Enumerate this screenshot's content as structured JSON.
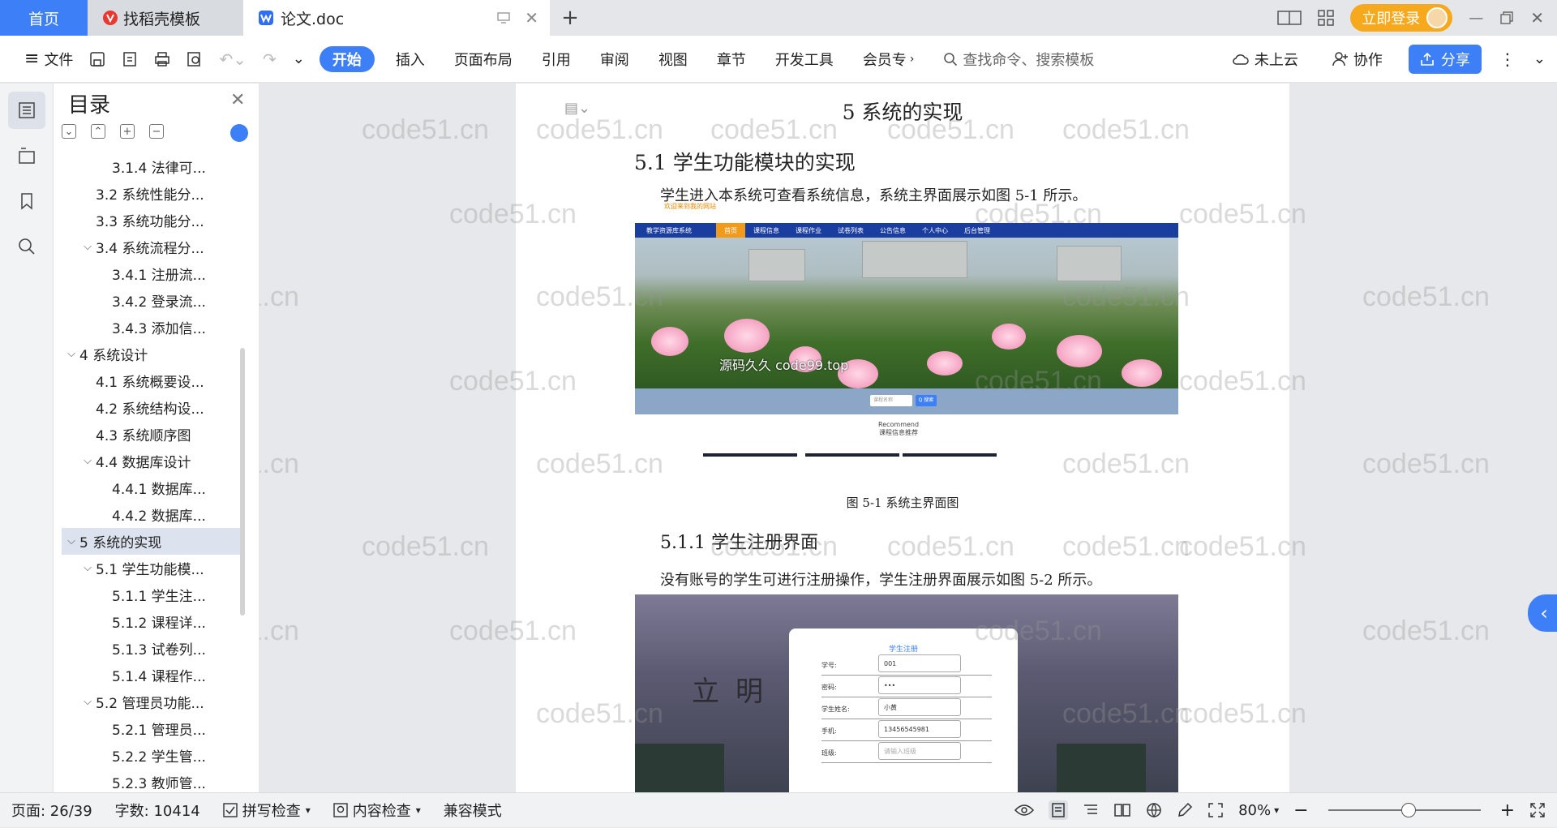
{
  "titlebar": {
    "home_tab": "首页",
    "template_tab": "找稻壳模板",
    "doc_tab": "论文.doc",
    "add_tab": "+",
    "login": "立即登录"
  },
  "ribbon": {
    "file": "文件",
    "tabs": [
      "开始",
      "插入",
      "页面布局",
      "引用",
      "审阅",
      "视图",
      "章节",
      "开发工具",
      "会员专"
    ],
    "search": "查找命令、搜索模板",
    "cloud": "未上云",
    "collab": "协作",
    "share": "分享"
  },
  "toc": {
    "title": "目录",
    "items": [
      {
        "label": "3.1.4 法律可...",
        "level": 3
      },
      {
        "label": "3.2 系统性能分...",
        "level": 2
      },
      {
        "label": "3.3 系统功能分...",
        "level": 2
      },
      {
        "label": "3.4 系统流程分...",
        "level": 2,
        "arrow": "⌵"
      },
      {
        "label": "3.4.1 注册流...",
        "level": 3
      },
      {
        "label": "3.4.2 登录流...",
        "level": 3
      },
      {
        "label": "3.4.3 添加信...",
        "level": 3
      },
      {
        "label": "4  系统设计",
        "level": 1,
        "arrow": "⌵"
      },
      {
        "label": "4.1 系统概要设...",
        "level": 2
      },
      {
        "label": "4.2 系统结构设...",
        "level": 2
      },
      {
        "label": "4.3  系统顺序图",
        "level": 2
      },
      {
        "label": "4.4 数据库设计",
        "level": 2,
        "arrow": "⌵"
      },
      {
        "label": "4.4.1  数据库...",
        "level": 3
      },
      {
        "label": "4.4.2  数据库...",
        "level": 3
      },
      {
        "label": "5  系统的实现",
        "level": 1,
        "arrow": "⌵",
        "selected": true
      },
      {
        "label": "5.1 学生功能模...",
        "level": 2,
        "arrow": "⌵"
      },
      {
        "label": "5.1.1  学生注...",
        "level": 3
      },
      {
        "label": "5.1.2  课程详...",
        "level": 3
      },
      {
        "label": "5.1.3  试卷列...",
        "level": 3
      },
      {
        "label": "5.1.4  课程作...",
        "level": 3
      },
      {
        "label": "5.2 管理员功能...",
        "level": 2,
        "arrow": "⌵"
      },
      {
        "label": "5.2.1  管理员...",
        "level": 3
      },
      {
        "label": "5.2.2  学生管...",
        "level": 3
      },
      {
        "label": "5.2.3  教师管...",
        "level": 3
      }
    ]
  },
  "document": {
    "chapter_title": "5  系统的实现",
    "section_title": "5.1 学生功能模块的实现",
    "para1": "学生进入本系统可查看系统信息，系统主界面展示如图 5-1 所示。",
    "fig1_caption": "图 5-1 系统主界面图",
    "subsection_title": "5.1.1  学生注册界面",
    "para2": "没有账号的学生可进行注册操作，学生注册界面展示如图 5-2 所示。",
    "watermark": "code51.cn",
    "fig1": {
      "welcome": "欢迎来到我的网站",
      "site_name": "教学资源库系统",
      "nav": [
        "首页",
        "课程信息",
        "课程作业",
        "试卷列表",
        "公告信息",
        "个人中心",
        "后台管理"
      ],
      "hero_text": "源码久久 code99.top",
      "search_placeholder": "课程名称",
      "search_button": "Q 搜索",
      "recommend_en": "Recommend",
      "recommend_cn": "课程信息推荐"
    },
    "fig2": {
      "sign": "立明  创新",
      "form_title": "学生注册",
      "fields": [
        {
          "label": "学号:",
          "value": "001",
          "placeholder": false
        },
        {
          "label": "密码:",
          "value": "•••",
          "placeholder": false
        },
        {
          "label": "学生姓名:",
          "value": "小黄",
          "placeholder": false
        },
        {
          "label": "手机:",
          "value": "13456545981",
          "placeholder": false
        },
        {
          "label": "班级:",
          "value": "请输入班级",
          "placeholder": true
        }
      ]
    }
  },
  "status": {
    "page": "页面: 26/39",
    "words": "字数: 10414",
    "spell": "拼写检查",
    "content_check": "内容检查",
    "compat": "兼容模式",
    "zoom": "80%",
    "zoom_value": 80
  }
}
